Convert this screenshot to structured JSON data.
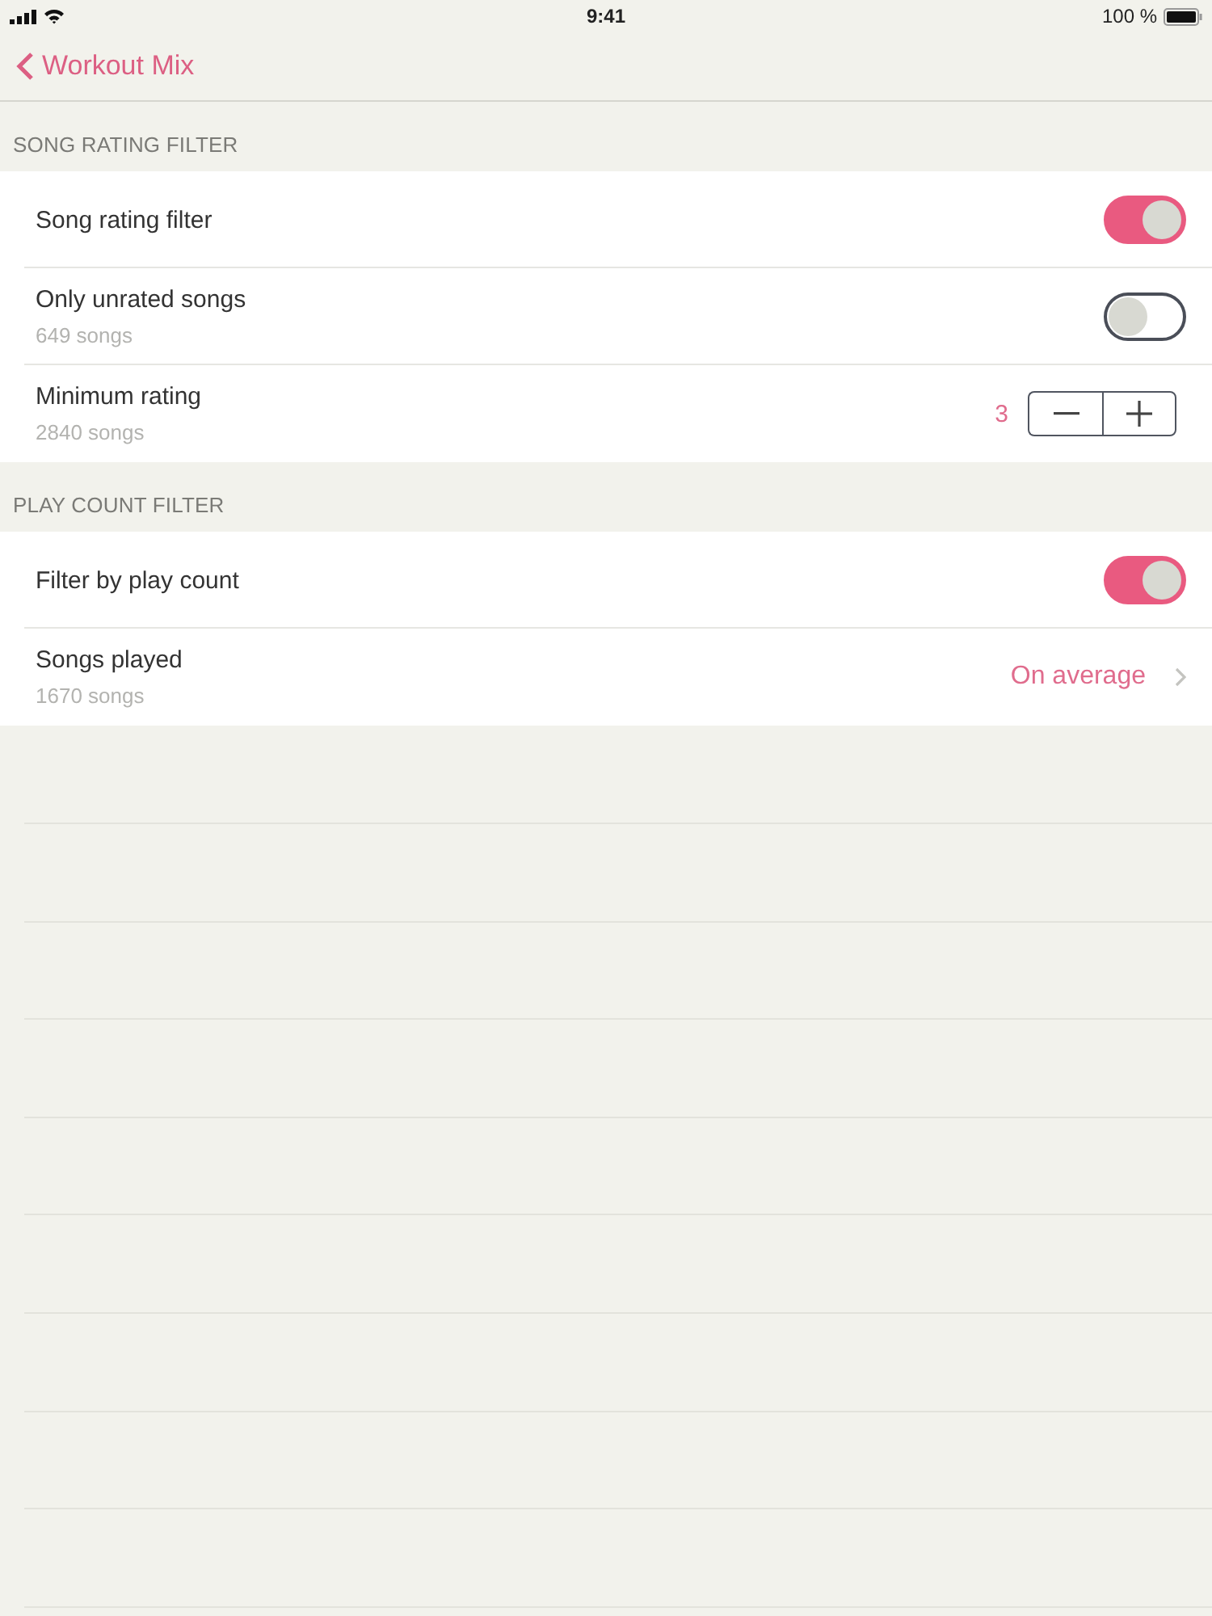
{
  "status_bar": {
    "time": "9:41",
    "battery": "100 %"
  },
  "nav": {
    "back_label": "Workout Mix"
  },
  "sections": [
    {
      "header": "SONG RATING FILTER",
      "rows": [
        {
          "kind": "toggle",
          "title": "Song rating filter",
          "on": true
        },
        {
          "kind": "toggle",
          "title": "Only unrated songs",
          "subtitle": "649 songs",
          "on": false
        },
        {
          "kind": "stepper",
          "title": "Minimum rating",
          "subtitle": "2840 songs",
          "value": "3"
        }
      ]
    },
    {
      "header": "PLAY COUNT FILTER",
      "rows": [
        {
          "kind": "toggle",
          "title": "Filter by play count",
          "on": true
        },
        {
          "kind": "disclosure",
          "title": "Songs played",
          "subtitle": "1670 songs",
          "value": "On average"
        }
      ]
    }
  ]
}
